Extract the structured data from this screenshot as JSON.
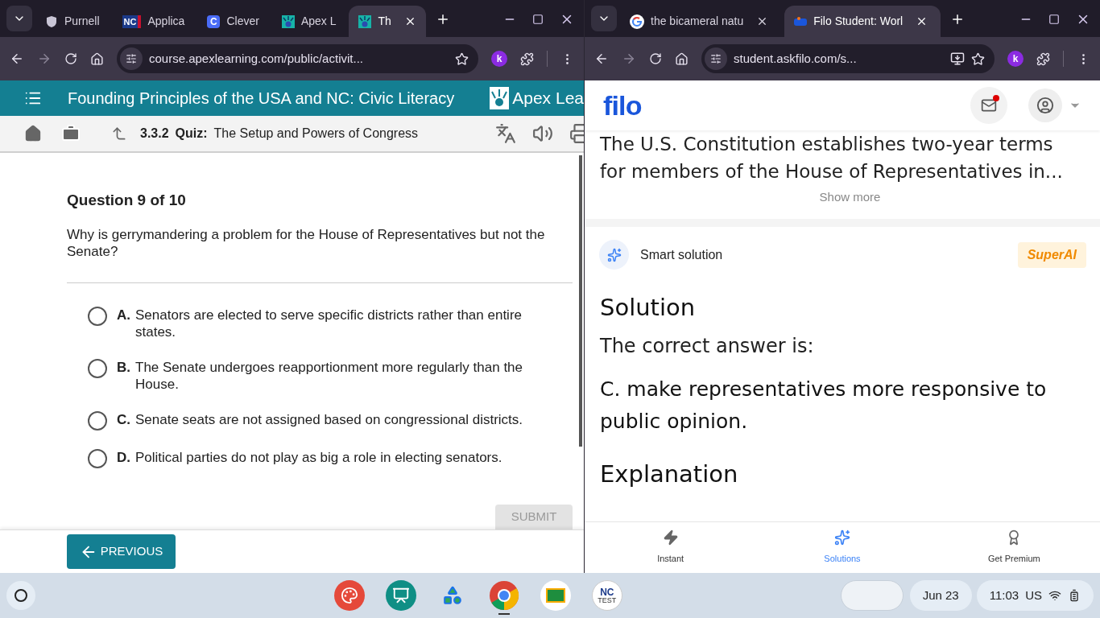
{
  "windows": [
    {
      "tabs": [
        {
          "title": "Purnell",
          "kind": "shield",
          "selected": false,
          "closable": false
        },
        {
          "title": "Applica",
          "kind": "nc",
          "badge": "NC",
          "selected": false,
          "closable": false
        },
        {
          "title": "Clever",
          "kind": "letter",
          "badge": "C",
          "selected": false,
          "closable": false
        },
        {
          "title": "Apex L",
          "kind": "apex",
          "selected": false,
          "closable": false
        },
        {
          "title": "Th",
          "kind": "apex",
          "selected": true,
          "closable": true
        }
      ],
      "url": "course.apexlearning.com/public/activit...",
      "install_icon": false,
      "extension_badge": "k"
    },
    {
      "tabs": [
        {
          "title": "the bicameral natu",
          "kind": "google",
          "selected": false,
          "closable": true
        },
        {
          "title": "Filo Student: Worl",
          "kind": "filo",
          "selected": true,
          "closable": true
        }
      ],
      "url": "student.askfilo.com/s...",
      "install_icon": true,
      "extension_badge": "k"
    }
  ],
  "apex": {
    "course_title": "Founding Principles of the USA and NC: Civic Literacy",
    "logo_text": "Apex Lea",
    "lesson_number": "3.3.2",
    "lesson_type": "Quiz:",
    "lesson_title": "The Setup and Powers of Congress",
    "question_heading": "Question 9 of 10",
    "question": "Why is gerrymandering a problem for the House of Representatives but not the Senate?",
    "choices": [
      {
        "letter": "A.",
        "text": "Senators are elected to serve specific districts rather than entire states.",
        "selected": false
      },
      {
        "letter": "B.",
        "text": "The Senate undergoes reapportionment more regularly than the House.",
        "selected": false
      },
      {
        "letter": "C.",
        "text": "Senate seats are not assigned based on congressional districts.",
        "selected": false
      },
      {
        "letter": "D.",
        "text": "Political parties do not play as big a role in electing senators.",
        "selected": false
      }
    ],
    "submit": {
      "label": "SUBMIT",
      "disabled": true
    },
    "previous": "PREVIOUS"
  },
  "filo": {
    "logo": "filo",
    "unread": true,
    "question_lines": [
      "The U.S. Constitution establishes two-year terms",
      "for members of the House of Representatives in..."
    ],
    "show_more": "Show more",
    "smart_solution": "Smart solution",
    "badge": "SuperAI",
    "solution_heading": "Solution",
    "intro": "The correct answer is:",
    "answer": "C. make representatives more responsive to public opinion.",
    "explanation_heading": "Explanation",
    "nav": [
      {
        "label": "Instant",
        "selected": false
      },
      {
        "label": "Solutions",
        "selected": true
      },
      {
        "label": "Get Premium",
        "selected": false
      }
    ]
  },
  "taskbar": {
    "apps": [
      {
        "kind": "palette"
      },
      {
        "kind": "cast"
      },
      {
        "kind": "puzzle"
      },
      {
        "kind": "chrome",
        "active": true
      },
      {
        "kind": "classroom"
      },
      {
        "kind": "nctest",
        "badge": "NC",
        "sub": "TEST"
      }
    ],
    "date": "Jun 23",
    "time": "11:03",
    "locale": "US"
  }
}
